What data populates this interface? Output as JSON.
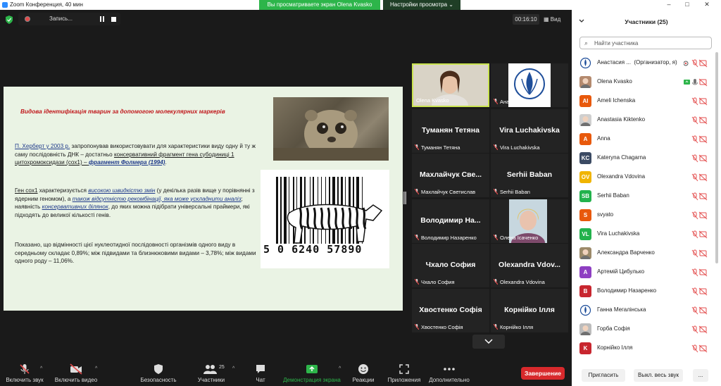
{
  "window": {
    "title": "Zoom Конференция, 40 мин"
  },
  "banner": {
    "sharing_text": "Вы просматриваете экран Olena Kvasko",
    "view_options": "Настройки просмотра"
  },
  "recording": {
    "label": "Запись..."
  },
  "timer": "00:16:10",
  "view_label": "Вид",
  "slide": {
    "title": "Видова ідентифікація тварин за допомогою молекулярних маркерів",
    "p1": {
      "author": "П. Херберт у 2003 р.",
      "text1": " запропонував використовувати для характеристики виду одну й ту ж саму послідовність ДНК – достатньо ",
      "u1": "консервативний фрагмент гена субодиниці 1 цитохромоксидази",
      "u1b": " (сох1) – ",
      "folmer": "фрагмент Фолмера (1994)",
      "end": "."
    },
    "p2": {
      "gene": "Ген сох1",
      "t1": " характеризується ",
      "u1": "високою швидкістю змін",
      "t2": " (у декілька разів вище у порівнянні з ядерним геномом), а ",
      "u2": "також відсутністю рекомбінації, яка може ускладнити аналіз",
      "t3": "; наявність ",
      "u3": "консервативних ділянок",
      "t4": ", до яких можна підібрати універсальні праймери, які підходять до великої кількості генів."
    },
    "p3": "Показано, що відмінності цієї нуклеотидної послідовності організмів одного виду в середньому складає 0,89%; між підвидами та близнюковими видами – 3,78%;  між видами одного роду – 11,06%.",
    "barcode_digits": "5 0  6240 57890"
  },
  "gallery": [
    {
      "big": "",
      "label": "Olena Kvasko"
    },
    {
      "big": "",
      "label": "Анастасія Нікітіна"
    },
    {
      "big": "Туманян Тетяна",
      "label": "Туманян Тетяна"
    },
    {
      "big": "Vira Luchakivska",
      "label": "Vira Luchakivska"
    },
    {
      "big": "Махлайчук Све...",
      "label": "Махлайчук Светислав"
    },
    {
      "big": "Serhii Baban",
      "label": "Serhii Baban"
    },
    {
      "big": "Володимир На...",
      "label": "Володимир Назаренко"
    },
    {
      "big": "",
      "label": "Олена Ісаченко"
    },
    {
      "big": "Чхало София",
      "label": "Чхало София"
    },
    {
      "big": "Olexandra Vdov...",
      "label": "Olexandra Vdovina"
    },
    {
      "big": "Хвостенко Софія",
      "label": "Хвостенко Софія"
    },
    {
      "big": "Корнійко Ілля",
      "label": "Корнійко Ілля"
    }
  ],
  "toolbar": {
    "audio": "Включить звук",
    "video": "Включить видео",
    "security": "Безопасность",
    "participants": "Участники",
    "participants_count": "25",
    "chat": "Чат",
    "share": "Демонстрация экрана",
    "reactions": "Реакции",
    "apps": "Приложения",
    "more": "Дополнительно",
    "end": "Завершение"
  },
  "panel": {
    "title": "Участники (25)",
    "search_placeholder": "Найти участника",
    "participants": [
      {
        "name": "Анастасия ...",
        "role": "(Организатор, я)",
        "initials": "",
        "color": "#ffffff",
        "avatar": "logo"
      },
      {
        "name": "Olena Kvasko",
        "role": "",
        "initials": "",
        "color": "#b48a6e",
        "avatar": "photo"
      },
      {
        "name": "Ameli  Ichenska",
        "role": "",
        "initials": "AI",
        "color": "#e8590c",
        "avatar": "initials"
      },
      {
        "name": "Anastasia Kiktenko",
        "role": "",
        "initials": "",
        "color": "#cfcfcf",
        "avatar": "photo"
      },
      {
        "name": "Anna",
        "role": "",
        "initials": "A",
        "color": "#e8590c",
        "avatar": "initials"
      },
      {
        "name": "Kateryna Chagarna",
        "role": "",
        "initials": "KC",
        "color": "#3b4a63",
        "avatar": "initials"
      },
      {
        "name": "Olexandra Vdovina",
        "role": "",
        "initials": "OV",
        "color": "#f0b400",
        "avatar": "initials"
      },
      {
        "name": "Serhii Baban",
        "role": "",
        "initials": "SB",
        "color": "#22b24c",
        "avatar": "initials"
      },
      {
        "name": "svyato",
        "role": "",
        "initials": "S",
        "color": "#e8590c",
        "avatar": "initials"
      },
      {
        "name": "Vira Luchakivska",
        "role": "",
        "initials": "VL",
        "color": "#22b24c",
        "avatar": "initials"
      },
      {
        "name": "Александра Варченко",
        "role": "",
        "initials": "",
        "color": "#9c8a6a",
        "avatar": "photo"
      },
      {
        "name": "Артемій Цибулько",
        "role": "",
        "initials": "A",
        "color": "#8e3fc2",
        "avatar": "initials"
      },
      {
        "name": "Володимир Назаренко",
        "role": "",
        "initials": "B",
        "color": "#c8262f",
        "avatar": "initials"
      },
      {
        "name": "Ганна Мегалінська",
        "role": "",
        "initials": "",
        "color": "#ffffff",
        "avatar": "logo"
      },
      {
        "name": "Горба Софія",
        "role": "",
        "initials": "",
        "color": "#bcbcbc",
        "avatar": "photo"
      },
      {
        "name": "Корнійко Ілля",
        "role": "",
        "initials": "K",
        "color": "#c8262f",
        "avatar": "initials"
      }
    ],
    "invite": "Пригласить",
    "mute_all": "Выкл. весь звук",
    "more": "..."
  },
  "colors": {
    "accent_green": "#2db54a",
    "end_red": "#d8292c",
    "muted_red": "#e34b4b",
    "speaker_border": "#c9e34f"
  }
}
